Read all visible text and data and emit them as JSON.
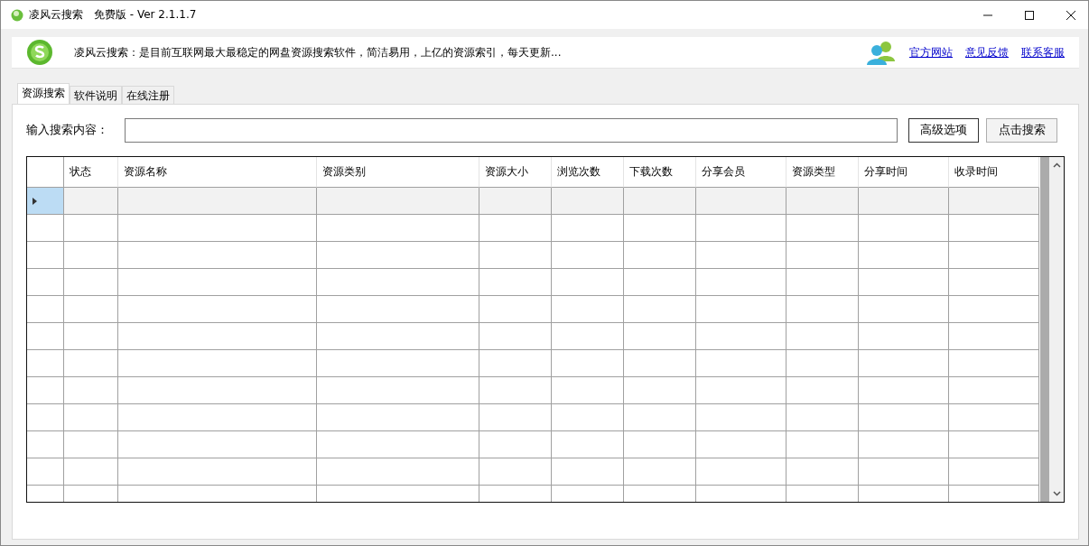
{
  "window": {
    "title": "凌风云搜索　免费版 - Ver 2.1.1.7"
  },
  "banner": {
    "text": "凌风云搜索：是目前互联网最大最稳定的网盘资源搜索软件，简洁易用，上亿的资源索引，每天更新...",
    "links": [
      "官方网站",
      "意见反馈",
      "联系客服"
    ]
  },
  "tabs": [
    {
      "label": "资源搜索",
      "selected": true
    },
    {
      "label": "软件说明",
      "selected": false
    },
    {
      "label": "在线注册",
      "selected": false
    }
  ],
  "search": {
    "label": "输入搜索内容：",
    "buttons": [
      "高级选项",
      "点击搜索"
    ]
  },
  "table": {
    "columns": [
      "状态",
      "资源名称",
      "资源类别",
      "资源大小",
      "浏览次数",
      "下载次数",
      "分享会员",
      "资源类型",
      "分享时间",
      "收录时间"
    ],
    "rows": [
      {
        "selected": true
      },
      {
        "selected": false
      },
      {
        "selected": false
      },
      {
        "selected": false
      },
      {
        "selected": false
      },
      {
        "selected": false
      },
      {
        "selected": false
      },
      {
        "selected": false
      },
      {
        "selected": false
      },
      {
        "selected": false
      },
      {
        "selected": false
      },
      {
        "selected": false
      }
    ]
  }
}
